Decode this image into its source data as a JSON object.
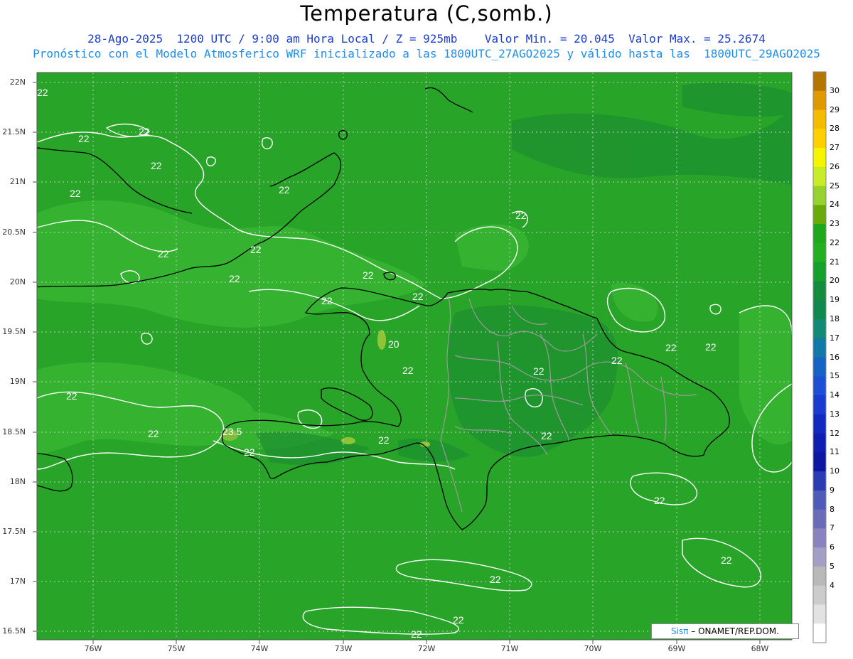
{
  "header": {
    "title": "Temperatura (C,somb.)",
    "date": "28-Ago-2025",
    "time_info": "1200 UTC / 9:00 am Hora Local / Z = 925mb",
    "min_value": "Valor Min. = 20.045",
    "max_value": "Valor Max. = 25.2674",
    "forecast_line": "Pronóstico con el Modelo Atmosferico WRF inicializado a las 1800UTC_27AGO2025 y válido hasta las  1800UTC_29AGO2025"
  },
  "axes": {
    "lat_labels": [
      "22N",
      "21.5N",
      "21N",
      "20.5N",
      "20N",
      "19.5N",
      "19N",
      "18.5N",
      "18N",
      "17.5N",
      "17N",
      "16.5N"
    ],
    "lon_labels": [
      "76W",
      "75W",
      "74W",
      "73W",
      "72W",
      "71W",
      "70W",
      "69W",
      "68W"
    ]
  },
  "colorbar": {
    "labels": [
      "30",
      "29",
      "28",
      "27",
      "26",
      "25",
      "24",
      "23",
      "22",
      "21",
      "20",
      "19",
      "18",
      "17",
      "16",
      "15",
      "14",
      "13",
      "12",
      "11",
      "10",
      "9",
      "8",
      "7",
      "6",
      "5",
      "4"
    ],
    "colors": [
      "#b37700",
      "#e09a00",
      "#f4bb00",
      "#ffd000",
      "#f5f500",
      "#c8ec28",
      "#98d230",
      "#6aab0a",
      "#1ea81e",
      "#22b022",
      "#15a12b",
      "#138c3e",
      "#11894e",
      "#118a76",
      "#1178a8",
      "#1663c6",
      "#1c4fd6",
      "#1a3bd0",
      "#1429c0",
      "#0e1eb0",
      "#0d16a0",
      "#2b3bb3",
      "#4f5bb8",
      "#6a6cb8",
      "#8a83c0",
      "#a39fc5",
      "#b9b9b9",
      "#cccccc",
      "#e2e2e2",
      "#ffffff"
    ]
  },
  "contour_labels": [
    "22",
    "22",
    "22",
    "22",
    "22",
    "22",
    "22",
    "22",
    "22",
    "22",
    "22",
    "22",
    "22",
    "22",
    "22",
    "22",
    "22",
    "22",
    "22",
    "22",
    "22",
    "22",
    "22",
    "22",
    "22",
    "22",
    "22",
    "22",
    "23.5",
    "20"
  ],
  "credit": {
    "system": "Sisπ",
    "org": "– ONAMET/REP.DOM."
  },
  "colors": {
    "background_field": "#26a326",
    "contour": "#ffffff",
    "coastline": "#000000",
    "provinces": "#9a9a9a",
    "grid": "#c9c9c9"
  }
}
